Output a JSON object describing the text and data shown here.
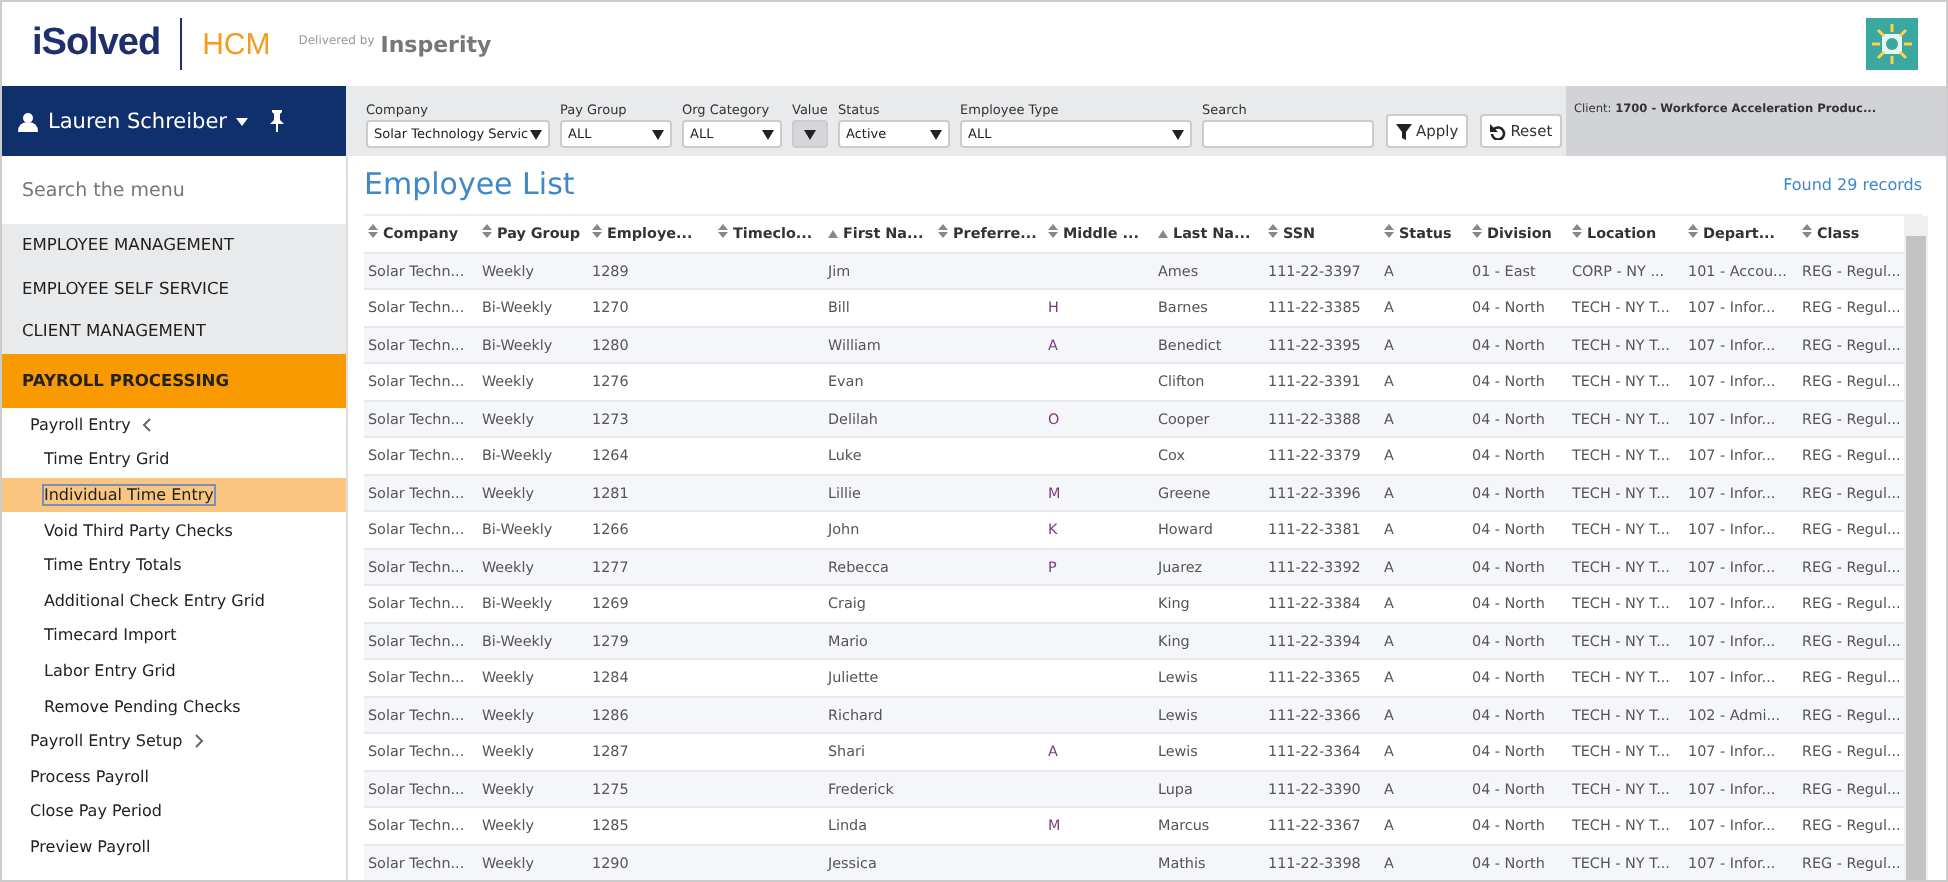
{
  "header": {
    "brand": "iSolved",
    "product": "HCM",
    "delivered_by": "Delivered by",
    "partner": "Insperity"
  },
  "user": {
    "name": "Lauren Schreiber"
  },
  "filters": [
    {
      "kind": "select",
      "label": "Company",
      "value": "Solar Technology Servic",
      "disabled": false
    },
    {
      "kind": "select",
      "label": "Pay Group",
      "value": "ALL",
      "disabled": false
    },
    {
      "kind": "select",
      "label": "Org Category",
      "value": "ALL",
      "disabled": false
    },
    {
      "kind": "select",
      "label": "Value",
      "disabled": true
    },
    {
      "kind": "select",
      "label": "Status",
      "value": "Active",
      "disabled": false
    },
    {
      "kind": "select",
      "label": "Employee Type",
      "value": "ALL",
      "disabled": false
    },
    {
      "kind": "input",
      "label": "Search"
    }
  ],
  "buttons": [
    {
      "kind": "apply",
      "label": "Apply"
    },
    {
      "kind": "reset",
      "label": "Reset"
    }
  ],
  "client": {
    "label": "Client:",
    "value": "1700 - Workforce Acceleration Produc..."
  },
  "sidebar": {
    "search_placeholder": "Search the menu",
    "items": [
      {
        "label": "EMPLOYEE MANAGEMENT",
        "selected": false
      },
      {
        "label": "EMPLOYEE SELF SERVICE",
        "selected": false
      },
      {
        "label": "CLIENT MANAGEMENT",
        "selected": false
      },
      {
        "label": "PAYROLL PROCESSING",
        "selected": true,
        "children": [
          {
            "label": "Payroll Entry",
            "selected": false,
            "expanded": true,
            "children": [
              {
                "label": "Time Entry Grid",
                "selected": false
              },
              {
                "label": "Individual Time Entry",
                "selected": true
              },
              {
                "label": "Void Third Party Checks",
                "selected": false
              },
              {
                "label": "Time Entry Totals",
                "selected": false
              },
              {
                "label": "Additional Check Entry Grid",
                "selected": false
              },
              {
                "label": "Timecard Import",
                "selected": false
              },
              {
                "label": "Labor Entry Grid",
                "selected": false
              },
              {
                "label": "Remove Pending Checks",
                "selected": false
              }
            ]
          },
          {
            "label": "Payroll Entry Setup",
            "selected": false,
            "expanded": false
          },
          {
            "label": "Process Payroll",
            "selected": false
          },
          {
            "label": "Close Pay Period",
            "selected": false
          },
          {
            "label": "Preview Payroll",
            "selected": false
          }
        ]
      }
    ]
  },
  "page": {
    "title": "Employee List",
    "record_count": "Found 29 records"
  },
  "table": {
    "columns": [
      {
        "label": "Company",
        "sorted": false
      },
      {
        "label": "Pay Group",
        "sorted": false
      },
      {
        "label": "Employe...",
        "sorted": false
      },
      {
        "label": "Timeclo...",
        "sorted": false
      },
      {
        "label": "First Na...",
        "sorted": true
      },
      {
        "label": "Preferre...",
        "sorted": false
      },
      {
        "label": "Middle ...",
        "sorted": false
      },
      {
        "label": "Last Na...",
        "sorted": true
      },
      {
        "label": "SSN",
        "sorted": false
      },
      {
        "label": "Status",
        "sorted": false
      },
      {
        "label": "Division",
        "sorted": false
      },
      {
        "label": "Location",
        "sorted": false
      },
      {
        "label": "Depart...",
        "sorted": false
      },
      {
        "label": "Class",
        "sorted": false
      }
    ],
    "rows": [
      [
        "Solar Techn...",
        "Weekly",
        "1289",
        "",
        "Jim",
        "",
        "",
        "Ames",
        "111-22-3397",
        "A",
        "01 - East",
        "CORP - NY ...",
        "101 - Accou...",
        "REG - Regul..."
      ],
      [
        "Solar Techn...",
        "Bi-Weekly",
        "1270",
        "",
        "Bill",
        "",
        "H",
        "Barnes",
        "111-22-3385",
        "A",
        "04 - North",
        "TECH - NY T...",
        "107 - Infor...",
        "REG - Regul..."
      ],
      [
        "Solar Techn...",
        "Bi-Weekly",
        "1280",
        "",
        "William",
        "",
        "A",
        "Benedict",
        "111-22-3395",
        "A",
        "04 - North",
        "TECH - NY T...",
        "107 - Infor...",
        "REG - Regul..."
      ],
      [
        "Solar Techn...",
        "Weekly",
        "1276",
        "",
        "Evan",
        "",
        "",
        "Clifton",
        "111-22-3391",
        "A",
        "04 - North",
        "TECH - NY T...",
        "107 - Infor...",
        "REG - Regul..."
      ],
      [
        "Solar Techn...",
        "Weekly",
        "1273",
        "",
        "Delilah",
        "",
        "O",
        "Cooper",
        "111-22-3388",
        "A",
        "04 - North",
        "TECH - NY T...",
        "107 - Infor...",
        "REG - Regul..."
      ],
      [
        "Solar Techn...",
        "Bi-Weekly",
        "1264",
        "",
        "Luke",
        "",
        "",
        "Cox",
        "111-22-3379",
        "A",
        "04 - North",
        "TECH - NY T...",
        "107 - Infor...",
        "REG - Regul..."
      ],
      [
        "Solar Techn...",
        "Weekly",
        "1281",
        "",
        "Lillie",
        "",
        "M",
        "Greene",
        "111-22-3396",
        "A",
        "04 - North",
        "TECH - NY T...",
        "107 - Infor...",
        "REG - Regul..."
      ],
      [
        "Solar Techn...",
        "Bi-Weekly",
        "1266",
        "",
        "John",
        "",
        "K",
        "Howard",
        "111-22-3381",
        "A",
        "04 - North",
        "TECH - NY T...",
        "107 - Infor...",
        "REG - Regul..."
      ],
      [
        "Solar Techn...",
        "Weekly",
        "1277",
        "",
        "Rebecca",
        "",
        "P",
        "Juarez",
        "111-22-3392",
        "A",
        "04 - North",
        "TECH - NY T...",
        "107 - Infor...",
        "REG - Regul..."
      ],
      [
        "Solar Techn...",
        "Bi-Weekly",
        "1269",
        "",
        "Craig",
        "",
        "",
        "King",
        "111-22-3384",
        "A",
        "04 - North",
        "TECH - NY T...",
        "107 - Infor...",
        "REG - Regul..."
      ],
      [
        "Solar Techn...",
        "Bi-Weekly",
        "1279",
        "",
        "Mario",
        "",
        "",
        "King",
        "111-22-3394",
        "A",
        "04 - North",
        "TECH - NY T...",
        "107 - Infor...",
        "REG - Regul..."
      ],
      [
        "Solar Techn...",
        "Weekly",
        "1284",
        "",
        "Juliette",
        "",
        "",
        "Lewis",
        "111-22-3365",
        "A",
        "04 - North",
        "TECH - NY T...",
        "107 - Infor...",
        "REG - Regul..."
      ],
      [
        "Solar Techn...",
        "Weekly",
        "1286",
        "",
        "Richard",
        "",
        "",
        "Lewis",
        "111-22-3366",
        "A",
        "04 - North",
        "TECH - NY T...",
        "102 - Admi...",
        "REG - Regul..."
      ],
      [
        "Solar Techn...",
        "Weekly",
        "1287",
        "",
        "Shari",
        "",
        "A",
        "Lewis",
        "111-22-3364",
        "A",
        "04 - North",
        "TECH - NY T...",
        "107 - Infor...",
        "REG - Regul..."
      ],
      [
        "Solar Techn...",
        "Weekly",
        "1275",
        "",
        "Frederick",
        "",
        "",
        "Lupa",
        "111-22-3390",
        "A",
        "04 - North",
        "TECH - NY T...",
        "107 - Infor...",
        "REG - Regul..."
      ],
      [
        "Solar Techn...",
        "Weekly",
        "1285",
        "",
        "Linda",
        "",
        "M",
        "Marcus",
        "111-22-3367",
        "A",
        "04 - North",
        "TECH - NY T...",
        "107 - Infor...",
        "REG - Regul..."
      ],
      [
        "Solar Techn...",
        "Weekly",
        "1290",
        "",
        "Jessica",
        "",
        "",
        "Mathis",
        "111-22-3398",
        "A",
        "04 - North",
        "TECH - NY T...",
        "107 - Infor...",
        "REG - Regul..."
      ]
    ]
  }
}
